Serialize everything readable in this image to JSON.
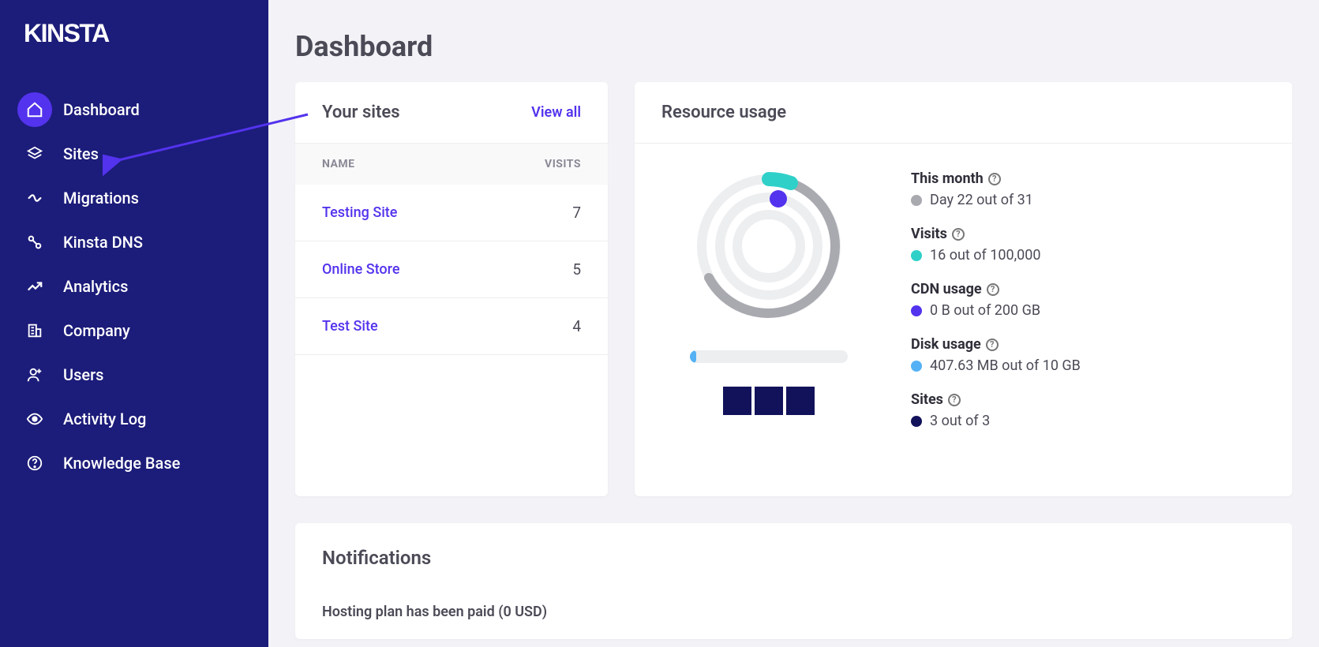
{
  "brand": "KInsta",
  "sidebar": {
    "items": [
      {
        "label": "Dashboard",
        "icon": "home-icon",
        "active": true
      },
      {
        "label": "Sites",
        "icon": "layers-icon",
        "active": false
      },
      {
        "label": "Migrations",
        "icon": "migrate-icon",
        "active": false
      },
      {
        "label": "Kinsta DNS",
        "icon": "dns-icon",
        "active": false
      },
      {
        "label": "Analytics",
        "icon": "analytics-icon",
        "active": false
      },
      {
        "label": "Company",
        "icon": "company-icon",
        "active": false
      },
      {
        "label": "Users",
        "icon": "users-icon",
        "active": false
      },
      {
        "label": "Activity Log",
        "icon": "eye-icon",
        "active": false
      },
      {
        "label": "Knowledge Base",
        "icon": "help-icon",
        "active": false
      }
    ]
  },
  "page_title": "Dashboard",
  "sites_card": {
    "title": "Your sites",
    "view_all": "View all",
    "col_name": "NAME",
    "col_visits": "VISITS",
    "rows": [
      {
        "name": "Testing Site",
        "visits": "7"
      },
      {
        "name": "Online Store",
        "visits": "5"
      },
      {
        "name": "Test Site",
        "visits": "4"
      }
    ]
  },
  "resource_card": {
    "title": "Resource usage",
    "stats": {
      "month": {
        "label": "This month",
        "value": "Day 22 out of 31",
        "color": "#a9a9b0"
      },
      "visits": {
        "label": "Visits",
        "value": "16 out of 100,000",
        "color": "#2fd0c8"
      },
      "cdn": {
        "label": "CDN usage",
        "value": "0 B out of 200 GB",
        "color": "#5333ed"
      },
      "disk": {
        "label": "Disk usage",
        "value": "407.63 MB out of 10 GB",
        "color": "#54b1f5"
      },
      "sites": {
        "label": "Sites",
        "value": "3 out of 3",
        "color": "#12125b"
      }
    }
  },
  "chart_data": {
    "type": "radial-progress",
    "rings": [
      {
        "name": "This month",
        "value": 22,
        "max": 31,
        "color": "#a9a9b0"
      },
      {
        "name": "Visits",
        "value": 16,
        "max": 100000,
        "color": "#2fd0c8"
      },
      {
        "name": "CDN usage",
        "value": 0,
        "max": 200,
        "unit": "GB",
        "color": "#5333ed"
      }
    ],
    "disk_bar": {
      "value": 407.63,
      "unit": "MB",
      "max": 10,
      "max_unit": "GB",
      "percent_filled": 4,
      "color": "#54b1f5"
    },
    "sites_boxes": {
      "filled": 3,
      "total": 3,
      "color": "#12125b"
    }
  },
  "notifications": {
    "title": "Notifications",
    "items": [
      {
        "text": "Hosting plan has been paid (0 USD)"
      }
    ]
  }
}
